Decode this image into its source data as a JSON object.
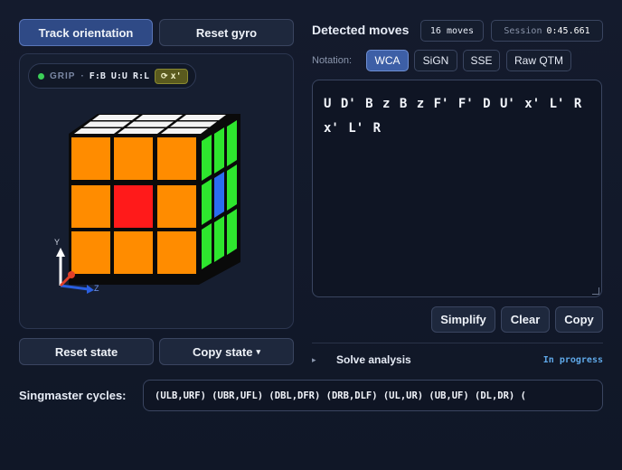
{
  "left": {
    "track_button": "Track orientation",
    "reset_gyro_button": "Reset gyro",
    "grip": {
      "label": "GRIP",
      "sep": "·",
      "mapping": "F:B U:U R:L",
      "rotation_icon": "rotate-icon",
      "rotation": "x'"
    },
    "axes": {
      "y": "Y",
      "z": "Z"
    },
    "reset_state_button": "Reset state",
    "copy_state_button": "Copy state",
    "copy_state_caret": "▾"
  },
  "right": {
    "title": "Detected moves",
    "moves_count": "16 moves",
    "session_label": "Session",
    "session_time": "0:45.661",
    "notation_label": "Notation:",
    "notations": [
      "WCA",
      "SiGN",
      "SSE",
      "Raw QTM"
    ],
    "active_notation": "WCA",
    "moves_text": "U D' B z B z F' F' D U' x' L' R x' L' R",
    "simplify_button": "Simplify",
    "clear_button": "Clear",
    "copy_button": "Copy",
    "solve_analysis": "Solve analysis",
    "solve_status": "In progress",
    "toggle_icon": "▸"
  },
  "footer": {
    "label": "Singmaster cycles:",
    "cycles": "(ULB,URF) (UBR,UFL) (DBL,DFR) (DRB,DLF) (UL,UR) (UB,UF) (DL,DR) ("
  },
  "colors": {
    "orange": "#ff8c00",
    "red": "#ff1a1a",
    "green": "#2ee62e",
    "blue": "#2a6df0",
    "white": "#f4f4f4",
    "accent": "#3d5fa6",
    "status": "#5fa8e8",
    "grip_dot": "#3ccf58"
  }
}
